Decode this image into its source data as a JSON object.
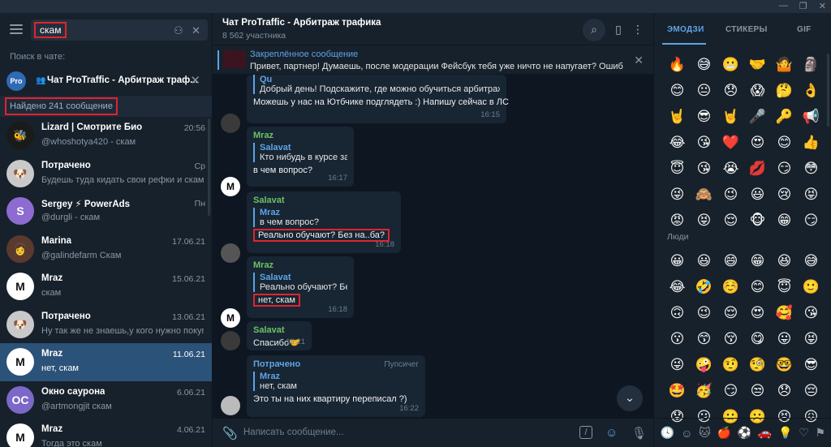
{
  "window": {
    "minimize": "—",
    "maximize": "❐",
    "close": "✕"
  },
  "left": {
    "search_value": "скам",
    "search_in_label": "Поиск в чате:",
    "scope_badge": "Pro",
    "scope_title": "Чат ProTraffic - Арбитраж траф...",
    "found_label": "Найдено 241 сообщение",
    "results": [
      {
        "name": "Lizard | Смотрите Био",
        "date": "20:56",
        "preview": "@whoshotya420 - скам",
        "avatar": "#1a1a1a",
        "initials": "🐝"
      },
      {
        "name": "Потрачено",
        "date": "Ср",
        "preview": "Будешь туда кидать свои рефки и скам-ш...",
        "avatar": "#c9c9c9",
        "initials": "🐶"
      },
      {
        "name": "Sergey ⚡ PowerAds",
        "date": "Пн",
        "preview": "@durgli - скам",
        "avatar": "#8e6bd1",
        "initials": "S"
      },
      {
        "name": "Marina",
        "date": "17.06.21",
        "preview": "@galindefarm Скам",
        "avatar": "#5a3a2e",
        "initials": "👩"
      },
      {
        "name": "Mraz",
        "date": "15.06.21",
        "preview": "скам",
        "avatar": "#ffffff",
        "initials": "M"
      },
      {
        "name": "Потрачено",
        "date": "13.06.21",
        "preview": "Ну так же не знаешь,у кого нужно покуп...",
        "avatar": "#c9c9c9",
        "initials": "🐶"
      },
      {
        "name": "Mraz",
        "date": "11.06.21",
        "preview": "нет, скам",
        "avatar": "#ffffff",
        "initials": "M"
      },
      {
        "name": "Окно сауронa",
        "date": "6.06.21",
        "preview": "@artmongjit скам",
        "avatar": "#7b68c8",
        "initials": "ОС"
      },
      {
        "name": "Mraz",
        "date": "4.06.21",
        "preview": "Тогда это скам",
        "avatar": "#ffffff",
        "initials": "M"
      }
    ]
  },
  "chat": {
    "title": "Чат ProTraffic - Арбитраж трафика",
    "subtitle": "8 562 участника",
    "pinned_label": "Закреплённое сообщение",
    "pinned_text": "Привет, партнер!  Думаешь, после модерации Фейсбук тебя уже ничто не напугает? Ошибаешь...",
    "messages": [
      {
        "quote_name": "Qu",
        "quote_text": "Добрый день! Подскажите, где можно обучиться арбитражу. ...",
        "text": "Можешь у нас на Ютбчике подглядеть :) Напишу сейчас в ЛС",
        "time": "16:15"
      },
      {
        "name": "Mraz",
        "quote_name": "Salavat",
        "quote_text": "Кто нибудь в курсе за...",
        "text": "в чем вопрос?",
        "time": "16:17"
      },
      {
        "name": "Salavat",
        "quote_name": "Mraz",
        "quote_text": "в чем вопрос?",
        "text": "Реально обучают? Без на..ба?",
        "time": "16:18"
      },
      {
        "name": "Mraz",
        "quote_name": "Salavat",
        "quote_text": "Реально обучают? Бе...",
        "text": "нет, скам",
        "time": "16:18"
      },
      {
        "name": "Salavat",
        "text": "Спасибо🤝",
        "time": "16:21"
      },
      {
        "name": "Потрачено",
        "forward": "Пупсичег",
        "quote_name": "Mraz",
        "quote_text": "нет, скам",
        "text": "Это ты на них квартиру переписал ?)",
        "time": "16:22"
      }
    ],
    "input_placeholder": "Написать сообщение..."
  },
  "emoji_panel": {
    "tabs": [
      "ЭМОДЗИ",
      "СТИКЕРЫ",
      "GIF"
    ],
    "recent": [
      "🔥",
      "😅",
      "😬",
      "🤝",
      "🤷",
      "🗿",
      "😊",
      "😐",
      "😞",
      "😱",
      "🤔",
      "👌",
      "🤘",
      "😎",
      "🤘",
      "🎤",
      "🔑",
      "📢",
      "😂",
      "😘",
      "❤️",
      "😍",
      "😊",
      "👍",
      "😇",
      "😘",
      "😭",
      "💋",
      "😏",
      "😳",
      "😜",
      "🙈",
      "😉",
      "😃",
      "😢",
      "😝",
      "😡",
      "😝",
      "😌",
      "🐵",
      "😁",
      "😏"
    ],
    "people_label": "Люди",
    "people": [
      "😀",
      "😃",
      "😄",
      "😁",
      "😆",
      "😅",
      "😂",
      "🤣",
      "☺️",
      "😊",
      "😇",
      "🙂",
      "🙃",
      "😉",
      "😌",
      "😍",
      "🥰",
      "😘",
      "😗",
      "😙",
      "😚",
      "😋",
      "😛",
      "😝",
      "😜",
      "🤪",
      "🤨",
      "🧐",
      "🤓",
      "😎",
      "🤩",
      "🥳",
      "😏",
      "😒",
      "😞",
      "😔",
      "😟",
      "😕",
      "🙁",
      "☹️",
      "😣",
      "😖"
    ],
    "categories": [
      "recent-icon",
      "smile-icon",
      "cat-icon",
      "food-icon",
      "sport-icon",
      "car-icon",
      "bulb-icon",
      "heart-icon",
      "flag-icon"
    ]
  }
}
